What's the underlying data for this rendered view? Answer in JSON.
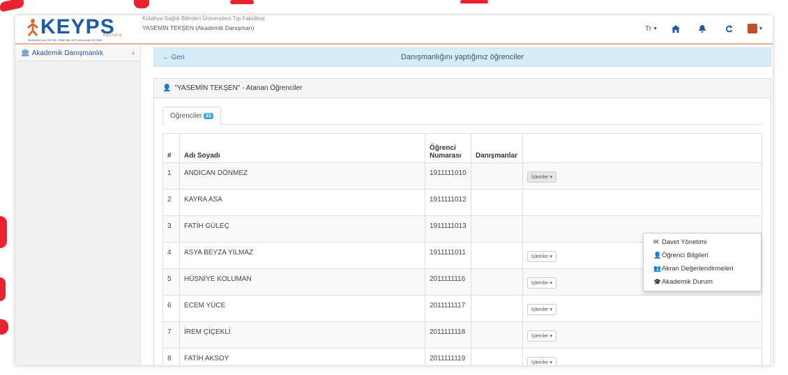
{
  "header": {
    "logo_text": "KEYPS",
    "logo_tag": "kantara",
    "logo_subtitle": "MURHANCAL EĞİTİM YÖNETİMİ VE PLANLAMA SİSTEMİ",
    "faculty": "Kütahya Sağlık Bilimleri Üniversitesi Tıp Fakültesi",
    "user": "YASEMİN TEKŞEN (Akademik Danışman)",
    "language": "Tr",
    "icons": [
      "home-icon",
      "bell-icon",
      "refresh-icon",
      "avatar"
    ]
  },
  "sidebar": {
    "items": [
      {
        "label": "Akademik Danışmanlık",
        "icon": "bank-icon"
      }
    ]
  },
  "infobar": {
    "back_label": "← Geri",
    "title": "Danışmanlığını yaptığınız öğrenciler"
  },
  "panel": {
    "title": "\"YASEMİN TEKŞEN\" - Atanan Öğrenciler",
    "tab_label": "Öğrenciler",
    "tab_count": "21"
  },
  "table": {
    "headers": [
      "#",
      "Adı Soyadı",
      "Öğrenci Numarası",
      "Danışmanlar",
      ""
    ],
    "header_student_no_line1": "Öğrenci",
    "header_student_no_line2": "Numarası",
    "action_label": "İşlemler",
    "rows": [
      {
        "no": "1",
        "name": "ANDICAN DÖNMEZ",
        "student_no": "1911111010"
      },
      {
        "no": "2",
        "name": "KAYRA ASA",
        "student_no": "1911111012"
      },
      {
        "no": "3",
        "name": "FATİH GÜLEÇ",
        "student_no": "1911111013"
      },
      {
        "no": "4",
        "name": "ASYA BEYZA YILMAZ",
        "student_no": "1911111011"
      },
      {
        "no": "5",
        "name": "HÜSNİYE KOLUMAN",
        "student_no": "2011111116"
      },
      {
        "no": "6",
        "name": "ECEM YÜCE",
        "student_no": "2011111117"
      },
      {
        "no": "7",
        "name": "İREM ÇİÇEKLİ",
        "student_no": "2011111118"
      },
      {
        "no": "8",
        "name": "FATİH AKSOY",
        "student_no": "2011111119"
      }
    ]
  },
  "dropdown": {
    "items": [
      {
        "label": "Davet Yönetimi",
        "icon": "envelope-icon"
      },
      {
        "label": "Öğrenci Bilgileri",
        "icon": "user-icon"
      },
      {
        "label": "Akran Değerlendirmeleri",
        "icon": "users-icon"
      },
      {
        "label": "Akademik Durum",
        "icon": "graduation-cap-icon"
      }
    ]
  },
  "colors": {
    "brand": "#1d5aa8",
    "accent": "#f0ad8c",
    "info_bg": "#d6edf8",
    "badge": "#3fa7db",
    "doodle": "#e8232f"
  }
}
